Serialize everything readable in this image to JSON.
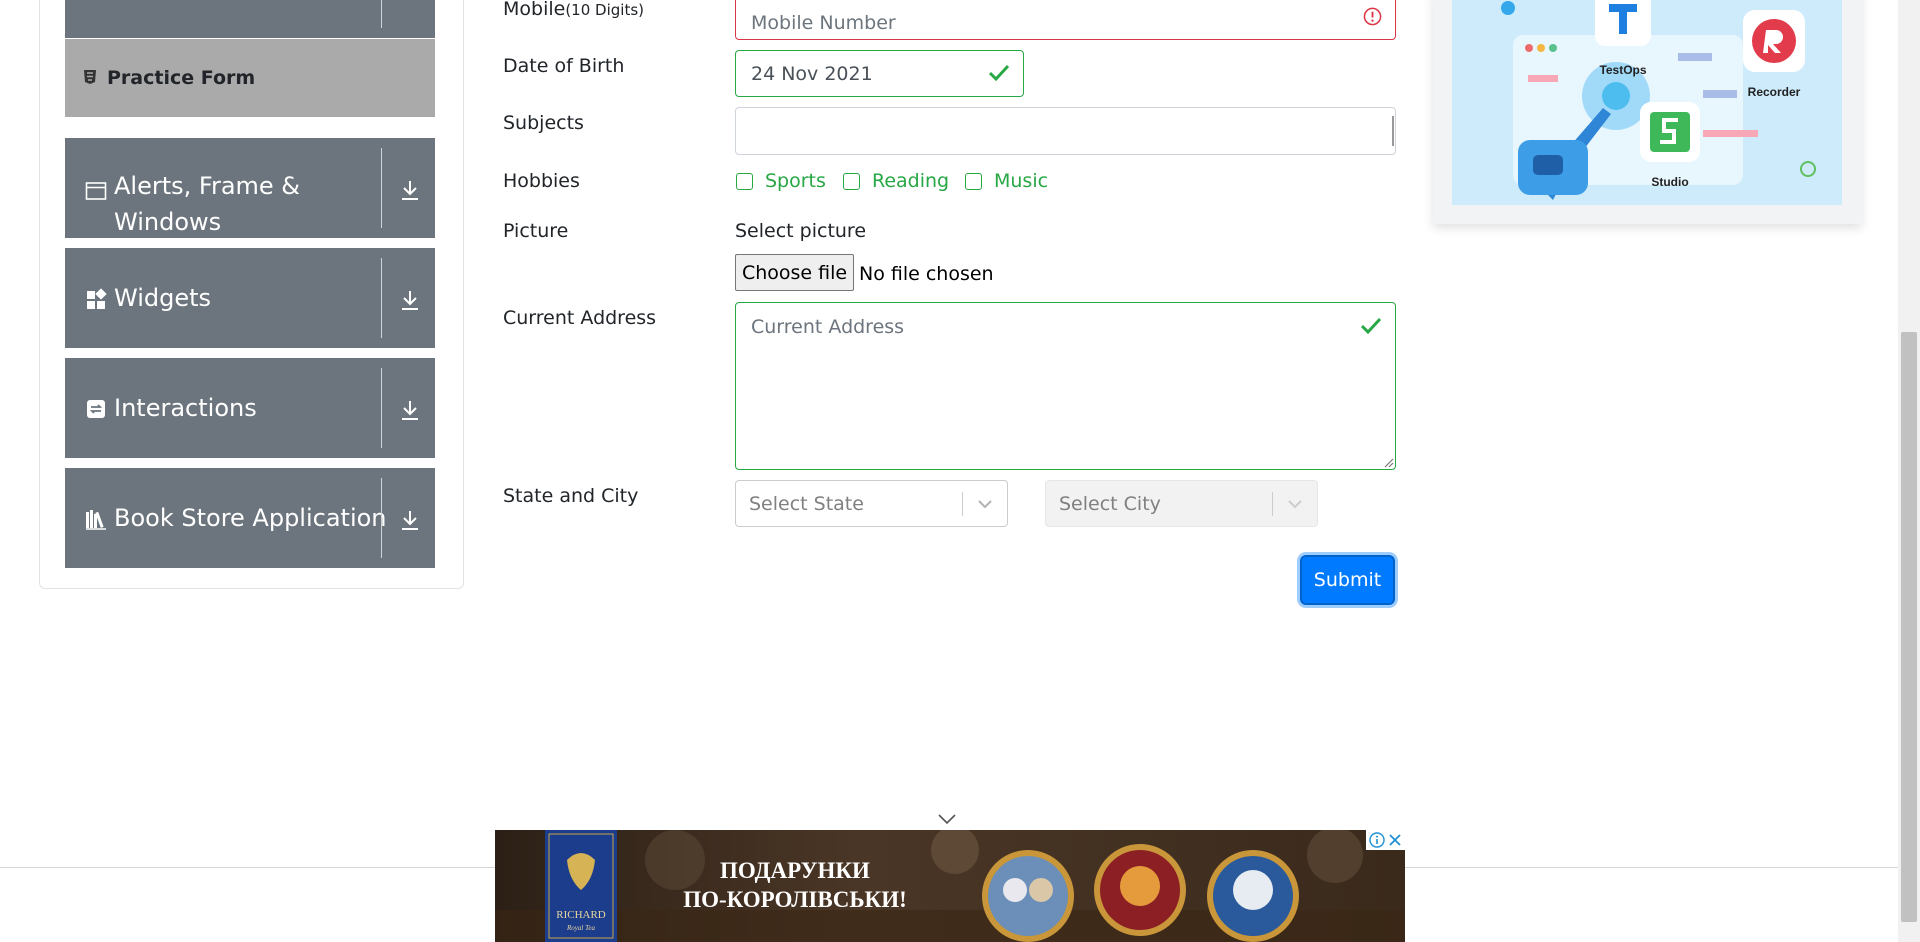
{
  "sidebar": {
    "practice_form_label": "Practice Form",
    "groups": [
      {
        "label_line1": "Alerts, Frame &",
        "label_line2": "Windows",
        "icon": "window-icon"
      },
      {
        "label": "Widgets",
        "icon": "widgets-icon"
      },
      {
        "label": "Interactions",
        "icon": "interactions-icon"
      },
      {
        "label": "Book Store Application",
        "icon": "books-icon"
      }
    ]
  },
  "form": {
    "mobile": {
      "label": "Mobile",
      "label_hint": "(10 Digits)",
      "placeholder": "Mobile Number"
    },
    "dob": {
      "label": "Date of Birth",
      "value": "24 Nov 2021"
    },
    "subjects": {
      "label": "Subjects",
      "value": ""
    },
    "hobbies": {
      "label": "Hobbies",
      "options": [
        "Sports",
        "Reading",
        "Music"
      ]
    },
    "picture": {
      "label": "Picture",
      "select_text": "Select picture",
      "button_label": "Choose file",
      "status": "No file chosen"
    },
    "address": {
      "label": "Current Address",
      "placeholder": "Current Address"
    },
    "state_city": {
      "label": "State and City",
      "state_placeholder": "Select State",
      "city_placeholder": "Select City"
    },
    "submit_label": "Submit"
  },
  "promo": {
    "apps": [
      "TestOps",
      "Recorder",
      "Studio"
    ]
  },
  "ad": {
    "brand": "RICHARD",
    "brand_sub": "Royal Tea",
    "headline_line1": "ПОДАРУНКИ",
    "headline_line2": "ПО-КОРОЛІВСЬКИ!"
  },
  "colors": {
    "sidebar_group_bg": "#6c757d",
    "practice_item_bg": "#aaaaaa",
    "valid_green": "#28a745",
    "invalid_red": "#dc3545",
    "submit_blue": "#007bff"
  }
}
